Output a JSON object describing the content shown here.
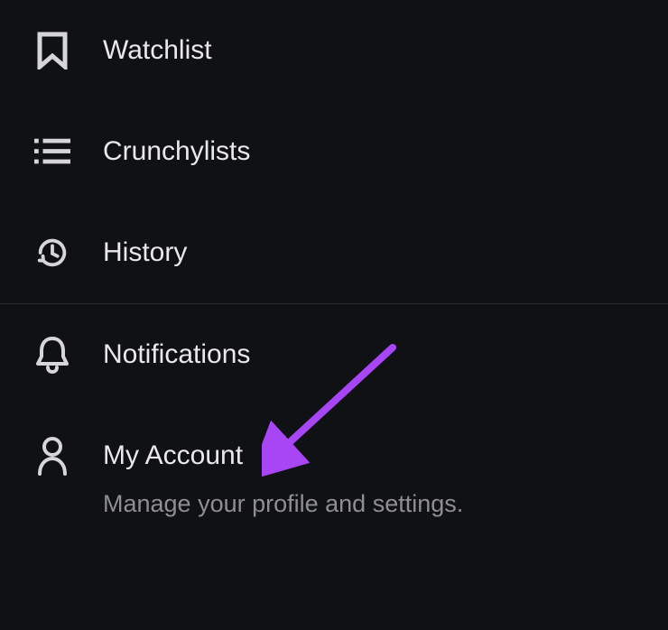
{
  "menu": {
    "section1": [
      {
        "id": "watchlist",
        "label": "Watchlist"
      },
      {
        "id": "crunchylists",
        "label": "Crunchylists"
      },
      {
        "id": "history",
        "label": "History"
      }
    ],
    "section2": [
      {
        "id": "notifications",
        "label": "Notifications"
      },
      {
        "id": "my-account",
        "label": "My Account",
        "sublabel": "Manage your profile and settings."
      }
    ]
  },
  "highlight_arrow": {
    "color": "#a846f5"
  }
}
